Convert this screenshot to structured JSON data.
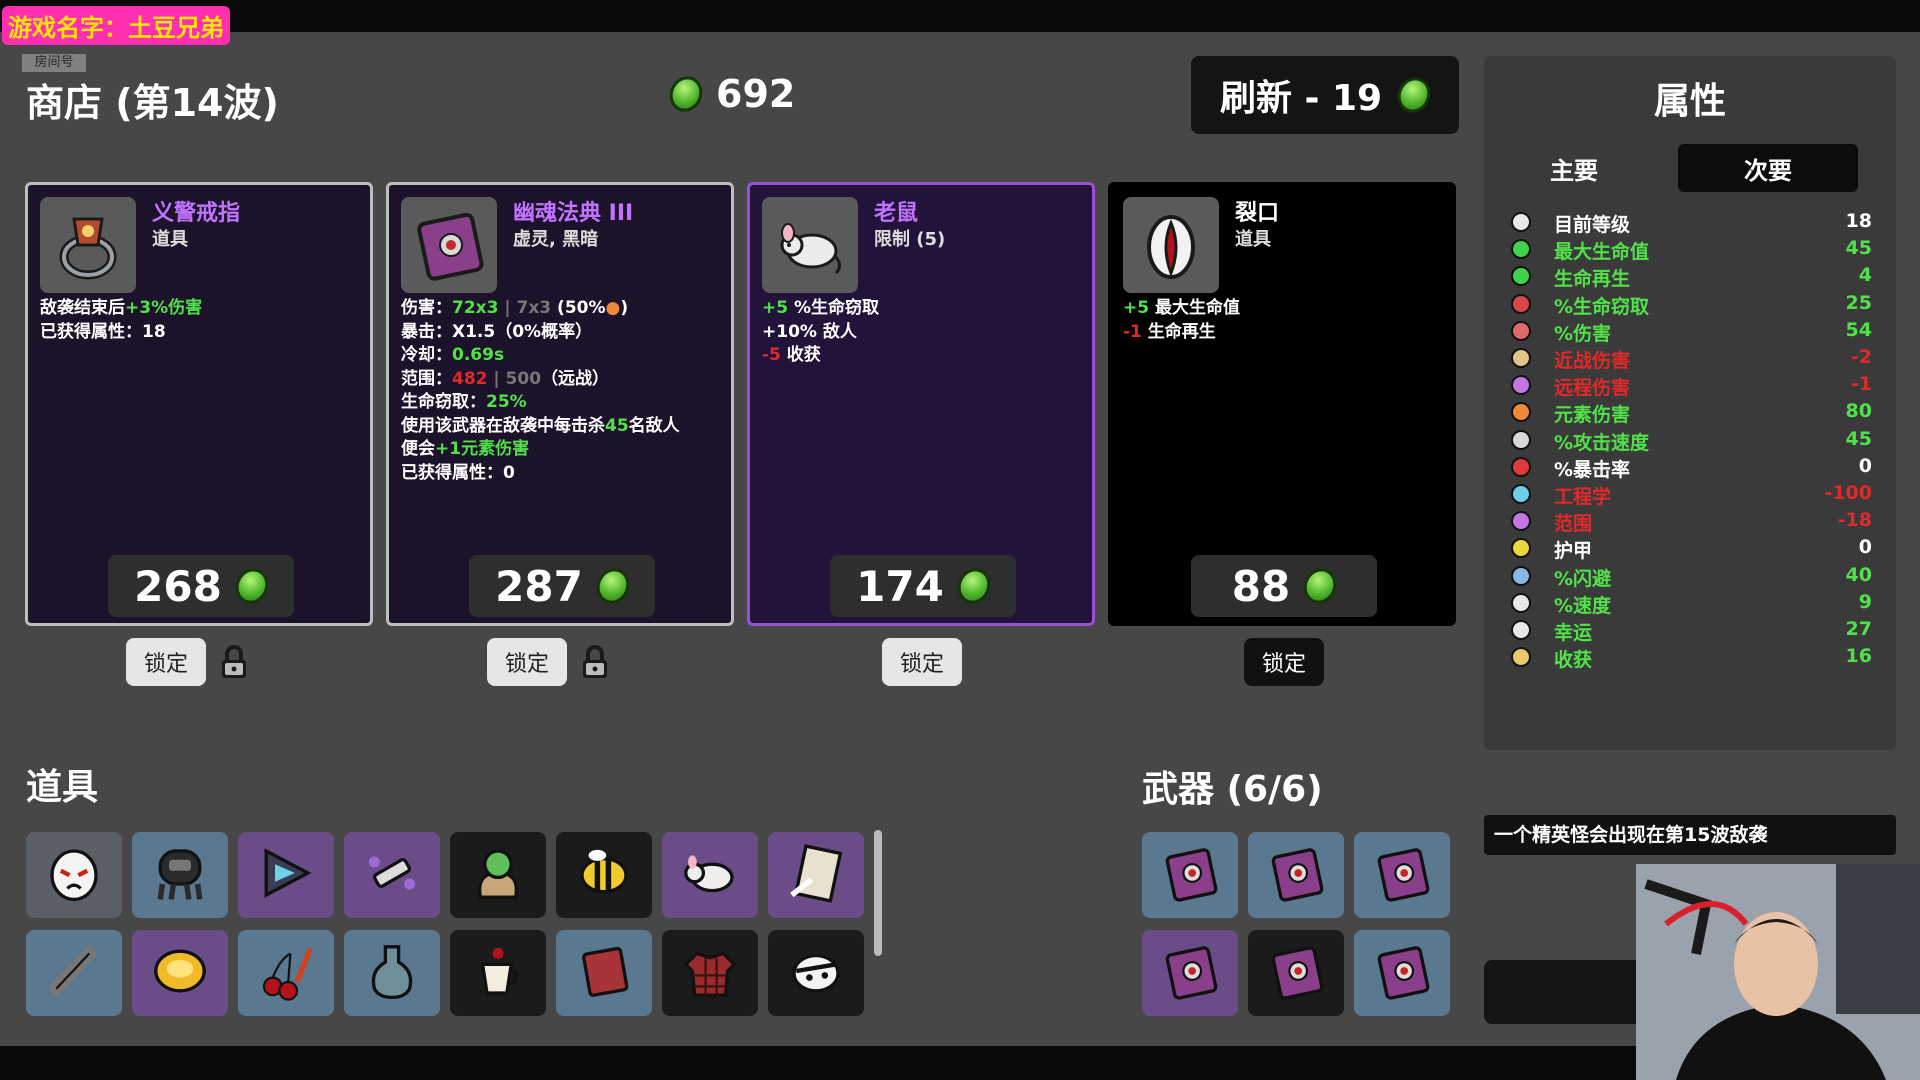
{
  "overlay": {
    "game_title": "游戏名字：土豆兄弟",
    "room_label": "房间号"
  },
  "shop": {
    "title": "商店 (第14波)",
    "money": "692",
    "refresh_label": "刷新 - 19"
  },
  "cards": [
    {
      "name": "义警戒指",
      "type": "道具",
      "desc": [
        [
          "敌袭结束后",
          "+3%伤害"
        ],
        [
          "已获得属性：18"
        ]
      ],
      "price": "268",
      "lock": "锁定",
      "icon": "ring-icon"
    },
    {
      "name": "幽魂法典 III",
      "type": "虚灵, 黑暗",
      "price": "287",
      "lock": "锁定",
      "icon": "ghost-tome-icon",
      "lines": {
        "dmg_label": "伤害：",
        "dmg": "72x3",
        "dmg_sep": " | ",
        "dmg_base": "7x3",
        "dmg_pct": " (50%",
        "dmg_end": ")",
        "crit": "暴击：X1.5（0%概率）",
        "cd_label": "冷却：",
        "cd": "0.69s",
        "range_label": "范围：",
        "range": "482",
        "range_sep": " | ",
        "range_base": "500",
        "range_type": "（远战）",
        "steal_label": "生命窃取：",
        "steal": "25%",
        "special1a": "使用该武器在敌袭中每击杀",
        "special1b": "45",
        "special1c": "名敌人",
        "special2a": "便会",
        "special2b": "+1元素伤害",
        "gained": "已获得属性：0"
      }
    },
    {
      "name": "老鼠",
      "type": "限制 (5)",
      "price": "174",
      "lock": "锁定",
      "icon": "rat-icon",
      "lines": {
        "l1a": "+5",
        "l1b": " %生命窃取",
        "l2": "+10% 敌人",
        "l3a": "-5",
        "l3b": " 收获"
      }
    },
    {
      "name": "裂口",
      "type": "道具",
      "price": "88",
      "lock": "锁定",
      "icon": "gash-icon",
      "lines": {
        "l1a": "+5",
        "l1b": " 最大生命值",
        "l2a": "-1",
        "l2b": " 生命再生"
      }
    }
  ],
  "inventory": {
    "items_title": "道具",
    "weapons_title": "武器 (6/6)",
    "items": [
      {
        "icon": "ghost-mask-icon",
        "tier": "gray"
      },
      {
        "icon": "diver-helmet-icon",
        "tier": "blue"
      },
      {
        "icon": "prism-icon",
        "tier": "purple"
      },
      {
        "icon": "syringe-icon",
        "tier": "purple"
      },
      {
        "icon": "plant-sack-icon",
        "tier": "black"
      },
      {
        "icon": "bee-icon",
        "tier": "black"
      },
      {
        "icon": "rat-icon",
        "tier": "purple"
      },
      {
        "icon": "order-scroll-icon",
        "tier": "purple"
      },
      {
        "icon": "bone-icon",
        "tier": "blue"
      },
      {
        "icon": "gold-coin-icon",
        "tier": "purple"
      },
      {
        "icon": "cherry-knife-icon",
        "tier": "blue"
      },
      {
        "icon": "potion-icon",
        "tier": "blue"
      },
      {
        "icon": "coffee-icon",
        "tier": "black"
      },
      {
        "icon": "red-book-icon",
        "tier": "blue"
      },
      {
        "icon": "plaid-shirt-icon",
        "tier": "black"
      },
      {
        "icon": "bandage-head-icon",
        "tier": "black"
      }
    ],
    "weapons": [
      {
        "icon": "ghost-tome-icon",
        "tier": "blue"
      },
      {
        "icon": "ghost-tome-icon",
        "tier": "blue"
      },
      {
        "icon": "ghost-tome-icon",
        "tier": "blue"
      },
      {
        "icon": "ghost-tome-icon",
        "tier": "purple"
      },
      {
        "icon": "ghost-tome-icon",
        "tier": "black"
      },
      {
        "icon": "ghost-tome-icon",
        "tier": "blue"
      }
    ]
  },
  "attributes": {
    "title": "属性",
    "tabs": [
      "主要",
      "次要"
    ],
    "stats": [
      {
        "name": "目前等级",
        "value": "18",
        "color": "white",
        "icon": "level-icon",
        "icon_color": "#e8e8e8"
      },
      {
        "name": "最大生命值",
        "value": "45",
        "color": "green",
        "icon": "heart-icon",
        "icon_color": "#3fd24a"
      },
      {
        "name": "生命再生",
        "value": "4",
        "color": "green",
        "icon": "regen-icon",
        "icon_color": "#3fd24a"
      },
      {
        "name": "%生命窃取",
        "value": "25",
        "color": "green",
        "icon": "fang-icon",
        "icon_color": "#d84848"
      },
      {
        "name": "%伤害",
        "value": "54",
        "color": "green",
        "icon": "brain-icon",
        "icon_color": "#e06a6a"
      },
      {
        "name": "近战伤害",
        "value": "-2",
        "color": "red",
        "icon": "sword-icon",
        "icon_color": "#e0c48a"
      },
      {
        "name": "远程伤害",
        "value": "-1",
        "color": "red",
        "icon": "bow-icon",
        "icon_color": "#c278e0"
      },
      {
        "name": "元素伤害",
        "value": "80",
        "color": "green",
        "icon": "flame-icon",
        "icon_color": "#f08a3a"
      },
      {
        "name": "%攻击速度",
        "value": "45",
        "color": "green",
        "icon": "hourglass-icon",
        "icon_color": "#d8d8d8"
      },
      {
        "name": "%暴击率",
        "value": "0",
        "color": "white",
        "icon": "crit-icon",
        "icon_color": "#e03a3a"
      },
      {
        "name": "工程学",
        "value": "-100",
        "color": "red",
        "icon": "wrench-icon",
        "icon_color": "#6ad0e8"
      },
      {
        "name": "范围",
        "value": "-18",
        "color": "red",
        "icon": "range-icon",
        "icon_color": "#c278e0"
      },
      {
        "name": "护甲",
        "value": "0",
        "color": "white",
        "icon": "shield-icon",
        "icon_color": "#e8d83a"
      },
      {
        "name": "%闪避",
        "value": "40",
        "color": "green",
        "icon": "dodge-icon",
        "icon_color": "#8ab8e8"
      },
      {
        "name": "%速度",
        "value": "9",
        "color": "green",
        "icon": "boot-icon",
        "icon_color": "#e8e8e8"
      },
      {
        "name": "幸运",
        "value": "27",
        "color": "green",
        "icon": "dice-icon",
        "icon_color": "#e8e8e8"
      },
      {
        "name": "收获",
        "value": "16",
        "color": "green",
        "icon": "wheat-icon",
        "icon_color": "#e8c86a"
      }
    ]
  },
  "notice": "一个精英怪会出现在第15波敌袭"
}
